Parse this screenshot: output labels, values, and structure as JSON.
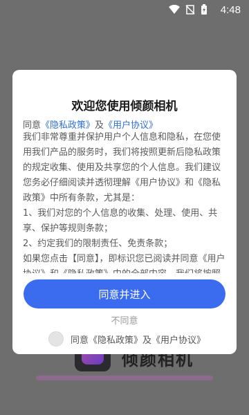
{
  "status_bar": {
    "time": "4:48",
    "icons": [
      "wifi-icon",
      "sim-no-signal-icon",
      "battery-charging-icon"
    ]
  },
  "background_app": {
    "title": "倾颜相机"
  },
  "dialog": {
    "title": "欢迎您使用倾颜相机",
    "agree_prefix": "同意",
    "privacy_link": "《隐私政策》",
    "and": "及",
    "user_link": "《用户协议》",
    "paragraphs": [
      "我们非常尊重并保护用户个人信息和隐私，在您使用我们产品的服务时，我们将按照更新后隐私政策的规定收集、使用及共享您的个人信息。我们建议您务必仔细阅读并透彻理解《用户协议》和《隐私政策》中所有条款，尤其是：",
      "1、我们对您的个人信息的收集、处理、使用、共享、保护等规则条款；",
      "2、约定我们的限制责任、免责条款；",
      "如果您点击【同意】，即标识您已阅读并同意《用户协议》和《隐私政策》中的全部内容，我们将按照更新后的协议为您提供相关的产品和服务。"
    ],
    "primary_button": "同意并进入",
    "secondary_button": "不同意",
    "consent_label": "同意《隐私政策》及《用户协议》"
  },
  "colors": {
    "accent": "#3b6cf0",
    "link": "#2f6fd6",
    "overlay": "#6e6e6e"
  }
}
